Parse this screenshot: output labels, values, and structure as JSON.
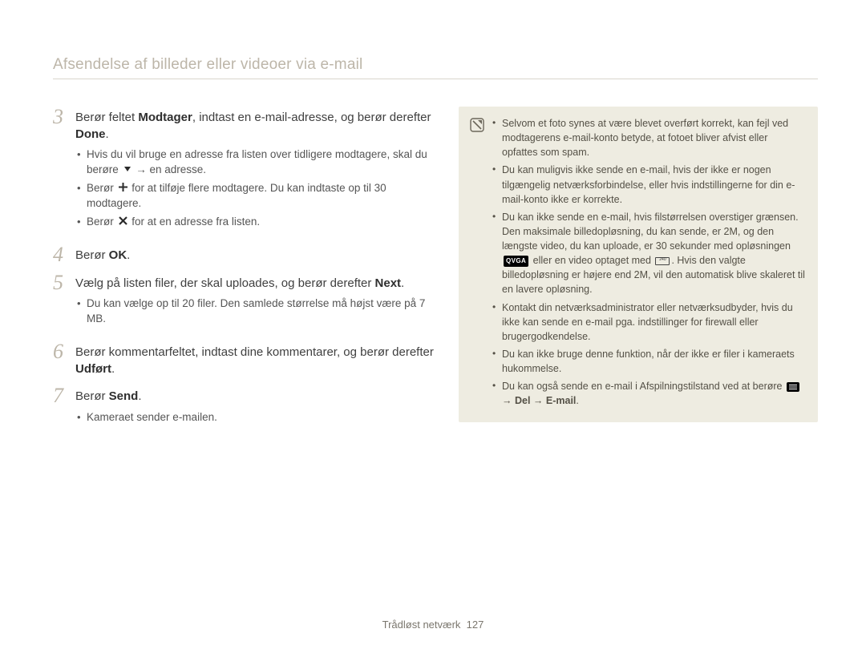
{
  "header": {
    "title": "Afsendelse af billeder eller videoer via e-mail"
  },
  "steps": {
    "s3": {
      "num": "3",
      "text_pre": "Berør feltet ",
      "b1": "Modtager",
      "text_mid": ", indtast en e-mail-adresse, og berør derefter ",
      "b2": "Done",
      "text_end": ".",
      "bullets": {
        "0_pre": "Hvis du vil bruge en adresse fra listen over tidligere modtagere, skal du berøre ",
        "0_post": " → en adresse.",
        "1_pre": "Berør ",
        "1_post": " for at tilføje flere modtagere. Du kan indtaste op til 30 modtagere.",
        "2_pre": "Berør ",
        "2_post": " for at en adresse fra listen."
      }
    },
    "s4": {
      "num": "4",
      "text_pre": "Berør ",
      "b1": "OK",
      "text_end": "."
    },
    "s5": {
      "num": "5",
      "text_pre": "Vælg på listen filer, der skal uploades, og berør derefter ",
      "b1": "Next",
      "text_end": ".",
      "bullets": {
        "0": "Du kan vælge op til 20 filer. Den samlede størrelse må højst være på 7 MB."
      }
    },
    "s6": {
      "num": "6",
      "text_pre": "Berør kommentarfeltet, indtast dine kommentarer, og berør derefter ",
      "b1": "Udført",
      "text_end": "."
    },
    "s7": {
      "num": "7",
      "text_pre": "Berør ",
      "b1": "Send",
      "text_end": ".",
      "bullets": {
        "0": "Kameraet sender e-mailen."
      }
    }
  },
  "notes": {
    "0": "Selvom et foto synes at være blevet overført korrekt, kan fejl ved modtagerens e-mail-konto betyde, at fotoet bliver afvist eller opfattes som spam.",
    "1": "Du kan muligvis ikke sende en e-mail, hvis der ikke er nogen tilgængelig netværksforbindelse, eller hvis indstillingerne for din e-mail-konto ikke er korrekte.",
    "2_pre": "Du kan ikke sende en e-mail, hvis filstørrelsen overstiger grænsen. Den maksimale billedopløsning, du kan sende, er 2M, og den længste video, du kan uploade, er 30 sekunder med opløsningen ",
    "2_mid": " eller en video optaget med ",
    "2_post": ". Hvis den valgte billedopløsning er højere end 2M, vil den automatisk blive skaleret til en lavere opløsning.",
    "3": "Kontakt din netværksadministrator eller netværksudbyder, hvis du ikke kan sende en e-mail pga. indstillinger for firewall eller brugergodkendelse.",
    "4": "Du kan ikke bruge denne funktion, når der ikke er filer i kameraets hukommelse.",
    "5_pre": "Du kan også sende en e-mail i Afspilningstilstand ved at berøre ",
    "5_mid": " → ",
    "5_b1": "Del",
    "5_b2": "E-mail",
    "5_end": "."
  },
  "icons": {
    "down": "down-triangle-icon",
    "plus": "plus-icon",
    "x": "x-icon",
    "note": "note-icon",
    "qvga": "QVGA",
    "menu": "menu-icon"
  },
  "footer": {
    "label": "Trådløst netværk",
    "page": "127"
  }
}
